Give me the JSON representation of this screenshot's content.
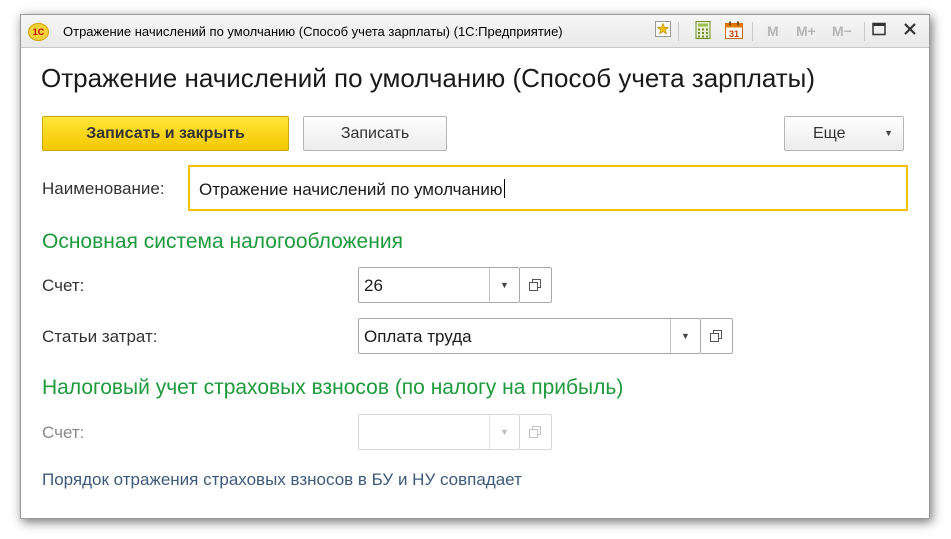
{
  "window": {
    "title": "Отражение начислений по умолчанию (Способ учета зарплаты)  (1С:Предприятие)",
    "app_logo_text": "1С",
    "toolbar": {
      "icons": [
        "favorites-icon",
        "calculator-icon",
        "calendar-icon"
      ],
      "calendar_day": "31",
      "memory_buttons": [
        "M",
        "M+",
        "M−"
      ],
      "window_icons": [
        "maximize-icon",
        "close-icon"
      ]
    }
  },
  "form": {
    "title": "Отражение начислений по умолчанию (Способ учета зарплаты)",
    "buttons": {
      "save_close": "Записать и закрыть",
      "save": "Записать",
      "more": "Еще"
    },
    "name": {
      "label": "Наименование:",
      "value": "Отражение начислений по умолчанию"
    },
    "section_main": {
      "title": "Основная система налогообложения",
      "account_label": "Счет:",
      "account_value": "26",
      "cost_label": "Статьи затрат:",
      "cost_value": "Оплата труда"
    },
    "section_tax": {
      "title": "Налоговый учет страховых взносов (по налогу на прибыль)",
      "account_label": "Счет:",
      "account_value": ""
    },
    "info_text": "Порядок отражения страховых взносов в БУ и НУ совпадает"
  },
  "colors": {
    "accent_yellow": "#f5c800",
    "section_green": "#1d9a3c",
    "info_blue": "#3d5a7a"
  }
}
